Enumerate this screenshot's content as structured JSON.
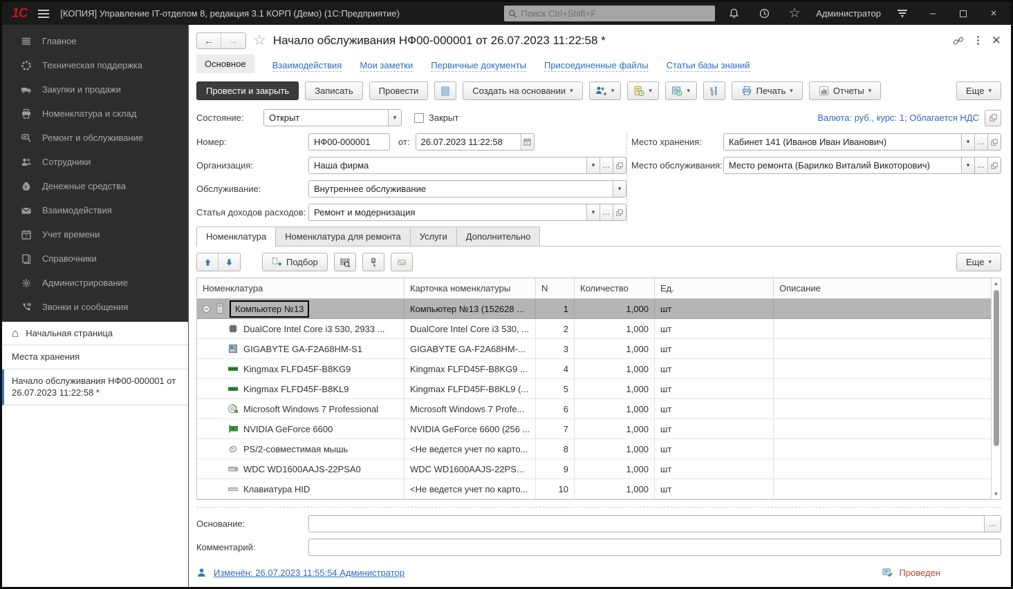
{
  "colors": {
    "accent_blue": "#2b6bc3",
    "titlebar_bg": "#1b1b1b",
    "sidebar_bg": "#2d2d2d",
    "selected_row": "#b5b5b5",
    "posted_text": "#b5452f",
    "primary_button_bg": "#3b3b3b"
  },
  "titlebar": {
    "logo": "1С",
    "title": "[КОПИЯ] Управление IT-отделом 8, редакция 3.1 КОРП (Демо)  (1С:Предприятие)",
    "search_placeholder": "Поиск Ctrl+Shift+F",
    "user": "Администратор"
  },
  "sidebar": {
    "items": [
      {
        "label": "Главное",
        "icon": "menu-lines-icon"
      },
      {
        "label": "Техническая поддержка",
        "icon": "support-icon"
      },
      {
        "label": "Закупки и продажи",
        "icon": "truck-icon"
      },
      {
        "label": "Номенклатура и склад",
        "icon": "printer-icon"
      },
      {
        "label": "Ремонт и обслуживание",
        "icon": "repair-icon"
      },
      {
        "label": "Сотрудники",
        "icon": "people-icon"
      },
      {
        "label": "Денежные средства",
        "icon": "money-icon"
      },
      {
        "label": "Взаимодействия",
        "icon": "mail-icon"
      },
      {
        "label": "Учет времени",
        "icon": "calendar-icon"
      },
      {
        "label": "Справочники",
        "icon": "books-icon"
      },
      {
        "label": "Администрирование",
        "icon": "gear-icon"
      },
      {
        "label": "Звонки и сообщения",
        "icon": "phone-icon"
      }
    ],
    "home_label": "Начальная страница",
    "window_items": [
      {
        "label": "Места хранения",
        "active": false
      },
      {
        "label": "Начало обслуживания НФ00-000001 от 26.07.2023 11:22:58 *",
        "active": true
      }
    ]
  },
  "doc": {
    "title": "Начало обслуживания НФ00-000001 от 26.07.2023 11:22:58 *",
    "nav_tabs": [
      {
        "label": "Основное",
        "active": true
      },
      {
        "label": "Взаимодействия",
        "active": false
      },
      {
        "label": "Мои заметки",
        "active": false
      },
      {
        "label": "Первичные документы",
        "active": false
      },
      {
        "label": "Присоединенные файлы",
        "active": false
      },
      {
        "label": "Статьи базы знаний",
        "active": false
      }
    ],
    "toolbar": {
      "post_close": "Провести и закрыть",
      "save": "Записать",
      "post": "Провести",
      "create_based": "Создать на основании",
      "print": "Печать",
      "reports": "Отчеты",
      "more": "Еще",
      "icon_buttons": [
        "database-icon",
        "add-person-icon",
        "doc-deadline-icon",
        "schedule-icon",
        "tools-icon"
      ]
    },
    "state": {
      "label": "Состояние:",
      "value": "Открыт",
      "closed_label": "Закрыт"
    },
    "currency_link": "Валюта: руб., курс: 1; Облагается НДС",
    "fields": {
      "number_label": "Номер:",
      "number": "НФ00-000001",
      "date_label": "от:",
      "date": "26.07.2023 11:22:58",
      "org_label": "Организация:",
      "org": "Наша фирма",
      "service_label": "Обслуживание:",
      "service": "Внутреннее обслуживание",
      "expense_label": "Статья доходов расходов:",
      "expense": "Ремонт и модернизация",
      "storage_label": "Место хранения:",
      "storage": "Кабинет 141 (Иванов Иван Иванович)",
      "service_place_label": "Место обслуживания:",
      "service_place": "Место ремонта (Барилко Виталий Викоторович)"
    },
    "table_tabs": [
      {
        "label": "Номенклатура",
        "active": true
      },
      {
        "label": "Номенклатура для ремонта",
        "active": false
      },
      {
        "label": "Услуги",
        "active": false
      },
      {
        "label": "Дополнительно",
        "active": false
      }
    ],
    "table_toolbar": {
      "pick": "Подбор",
      "more": "Еще",
      "icon_buttons": [
        "move-up-icon",
        "move-down-icon",
        "barcode-scan-icon",
        "scanner-device-icon",
        "serial-numbers-icon"
      ]
    },
    "table": {
      "columns": [
        "Номенклатура",
        "Карточка номенклатуры",
        "N",
        "Количество",
        "Ед.",
        "Описание"
      ],
      "rows": [
        {
          "name": "Компьютер №13",
          "card": "Компьютер №13 (152628 ...",
          "n": "1",
          "qty": "1,000",
          "unit": "шт",
          "desc": "",
          "icon": "computer-icon",
          "selected": true,
          "group": true
        },
        {
          "name": "DualCore Intel Core i3 530, 2933 ...",
          "card": "DualCore Intel Core i3 530, ...",
          "n": "2",
          "qty": "1,000",
          "unit": "шт",
          "desc": "",
          "icon": "cpu-icon",
          "selected": false,
          "group": false
        },
        {
          "name": "GIGABYTE GA-F2A68HM-S1",
          "card": "GIGABYTE GA-F2A68HM-...",
          "n": "3",
          "qty": "1,000",
          "unit": "шт",
          "desc": "",
          "icon": "motherboard-icon",
          "selected": false,
          "group": false
        },
        {
          "name": "Kingmax FLFD45F-B8KG9",
          "card": "Kingmax FLFD45F-B8KG9 ...",
          "n": "4",
          "qty": "1,000",
          "unit": "шт",
          "desc": "",
          "icon": "ram-icon",
          "selected": false,
          "group": false
        },
        {
          "name": "Kingmax FLFD45F-B8KL9",
          "card": "Kingmax FLFD45F-B8KL9 (...",
          "n": "5",
          "qty": "1,000",
          "unit": "шт",
          "desc": "",
          "icon": "ram-icon",
          "selected": false,
          "group": false
        },
        {
          "name": "Microsoft Windows 7 Professional",
          "card": "Microsoft Windows 7 Profe...",
          "n": "6",
          "qty": "1,000",
          "unit": "шт",
          "desc": "",
          "icon": "software-icon",
          "selected": false,
          "group": false
        },
        {
          "name": "NVIDIA GeForce 6600",
          "card": "NVIDIA GeForce 6600 (256 ...",
          "n": "7",
          "qty": "1,000",
          "unit": "шт",
          "desc": "",
          "icon": "gpu-icon",
          "selected": false,
          "group": false
        },
        {
          "name": "PS/2-совместимая мышь",
          "card": "<Не ведется учет по карто...",
          "n": "8",
          "qty": "1,000",
          "unit": "шт",
          "desc": "",
          "icon": "mouse-icon",
          "selected": false,
          "group": false
        },
        {
          "name": "WDC WD1600AAJS-22PSA0",
          "card": "WDC WD1600AAJS-22PS...",
          "n": "9",
          "qty": "1,000",
          "unit": "шт",
          "desc": "",
          "icon": "hdd-icon",
          "selected": false,
          "group": false
        },
        {
          "name": "Клавиатура HID",
          "card": "<Не ведется учет по карто...",
          "n": "10",
          "qty": "1,000",
          "unit": "шт",
          "desc": "",
          "icon": "keyboard-icon",
          "selected": false,
          "group": false
        }
      ]
    },
    "footer": {
      "basis_label": "Основание:",
      "comment_label": "Комментарий:",
      "modified_link": "Изменён: 26.07.2023 11:55:54 Администратор",
      "posted": "Проведен"
    }
  }
}
